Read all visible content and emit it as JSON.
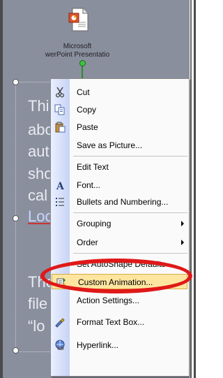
{
  "file": {
    "label_line1": "Microsoft",
    "label_line2": "werPoint Presentatio"
  },
  "slide_text": {
    "lines": [
      "Thi",
      "abc",
      "aut",
      "sho",
      "cal",
      "Loc",
      "The",
      "file",
      "“lo"
    ]
  },
  "menu": {
    "items": [
      {
        "label": "Cut",
        "icon": "scissors-icon"
      },
      {
        "label": "Copy",
        "icon": "copy-icon"
      },
      {
        "label": "Paste",
        "icon": "paste-icon"
      },
      {
        "label": "Save as Picture...",
        "icon": ""
      },
      {
        "label": "Edit Text",
        "icon": ""
      },
      {
        "label": "Font...",
        "icon": "font-icon"
      },
      {
        "label": "Bullets and Numbering...",
        "icon": "bullets-icon"
      },
      {
        "label": "Grouping",
        "icon": "",
        "submenu": true
      },
      {
        "label": "Order",
        "icon": "",
        "submenu": true
      },
      {
        "label": "Set AutoShape Defaults",
        "icon": ""
      },
      {
        "label": "Custom Animation...",
        "icon": "animation-icon",
        "highlighted": true
      },
      {
        "label": "Action Settings...",
        "icon": ""
      },
      {
        "label": "Format Text Box...",
        "icon": "format-icon"
      },
      {
        "label": "Hyperlink...",
        "icon": "hyperlink-icon"
      }
    ]
  },
  "colors": {
    "slide_bg": "#8a8f9e",
    "highlight_bg": "#ffe6a0",
    "annotation": "#e01818"
  }
}
